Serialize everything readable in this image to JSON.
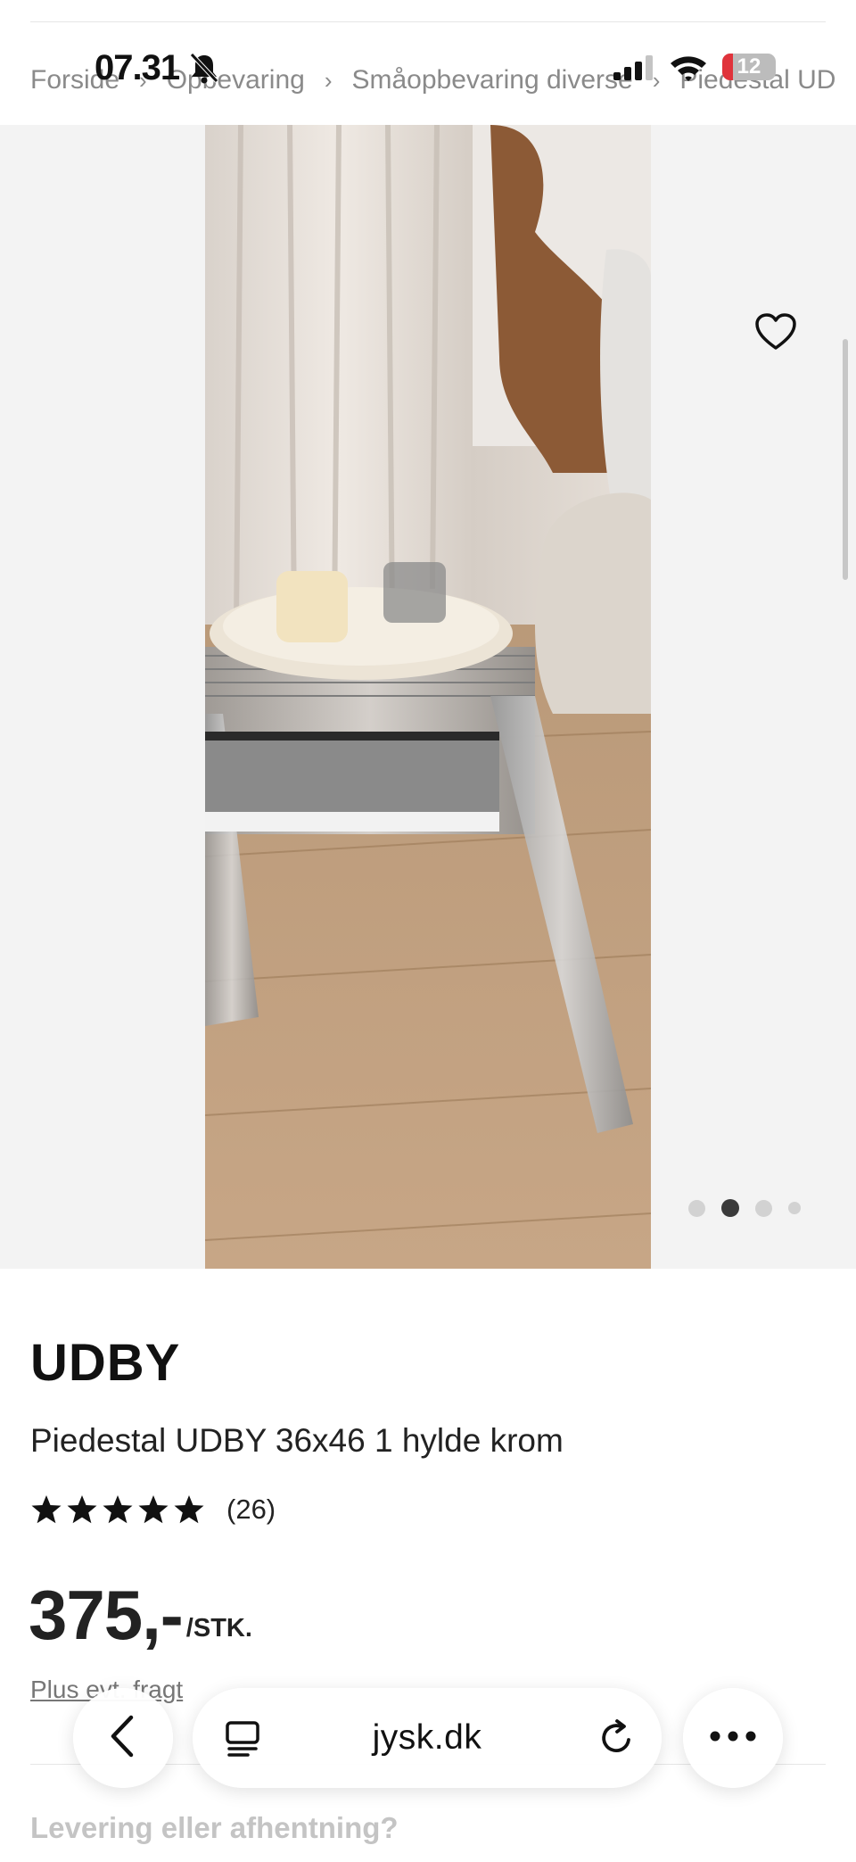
{
  "status_bar": {
    "time": "07.31",
    "battery_level": 0.2,
    "battery_label": "12"
  },
  "breadcrumb": [
    "Forside",
    "Opbevaring",
    "Småopbevaring diverse",
    "Piedestal UD"
  ],
  "gallery": {
    "dot_count": 4,
    "active_index": 1,
    "image_alt": "Piedestal UDBY in chrome with tray, glass, candle and book"
  },
  "product": {
    "brand": "UDBY",
    "name": "Piedestal UDBY 36x46 1 hylde krom",
    "rating": 5,
    "review_count": "(26)",
    "price": "375,-",
    "unit": "/STK.",
    "freight": "Plus evt. fragt",
    "delivery_heading": "Levering eller afhentning?"
  },
  "browser": {
    "url": "jysk.dk"
  },
  "icons": [
    "bell-slash-icon",
    "signal-icon",
    "wifi-icon",
    "battery-icon",
    "heart-icon",
    "star-icon",
    "back-icon",
    "tabs-icon",
    "reload-icon",
    "more-icon"
  ]
}
